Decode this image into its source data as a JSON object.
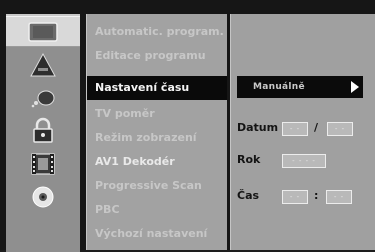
{
  "icons": [
    {
      "name": "disc-tray-icon",
      "active": true
    },
    {
      "name": "language-icon",
      "active": false
    },
    {
      "name": "audio-icon",
      "active": false
    },
    {
      "name": "lock-icon",
      "active": false
    },
    {
      "name": "film-icon",
      "active": false
    },
    {
      "name": "disc-icon",
      "active": false
    }
  ],
  "menu": {
    "items": [
      {
        "label": "Automatic. program.",
        "state": "dim"
      },
      {
        "label": "Editace programu",
        "state": "dim"
      },
      {
        "label": "Nastavení času",
        "state": "selected"
      },
      {
        "label": "TV poměr",
        "state": "dim"
      },
      {
        "label": "Režim zobrazení",
        "state": "dim"
      },
      {
        "label": "AV1 Dekodér",
        "state": "dim"
      },
      {
        "label": "Progressive Scan",
        "state": "dim"
      },
      {
        "label": "PBC",
        "state": "dim"
      },
      {
        "label": "Výchozí nastavení",
        "state": "dim"
      }
    ]
  },
  "clock": {
    "mode": "Manuálně",
    "date_label": "Datum",
    "date_day": "- -",
    "date_sep": "/",
    "date_month": "- -",
    "year_label": "Rok",
    "year_value": "- - - -",
    "time_label": "Čas",
    "time_hour": "- -",
    "time_sep": ":",
    "time_minute": "- -"
  },
  "colors": {
    "selected_bg": "#0a0a0a",
    "panel_bg": "#a2a2a2",
    "active_icon_bg": "#d9d9d9"
  }
}
